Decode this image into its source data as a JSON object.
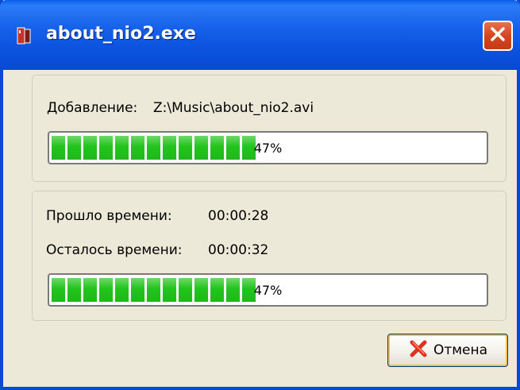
{
  "window": {
    "title": "about_nio2.exe",
    "titlebar_color": "#0b55e0"
  },
  "file_panel": {
    "adding_label": "Добавление:",
    "adding_path": "Z:\\Music\\about_nio2.avi",
    "progress_value": 47,
    "progress_text": "47%"
  },
  "time_panel": {
    "elapsed_label": "Прошло времени:",
    "elapsed_value": "00:00:28",
    "remaining_label": "Осталось времени:",
    "remaining_value": "00:00:32",
    "progress_value": 47,
    "progress_text": "47%"
  },
  "actions": {
    "cancel_label": "Отмена"
  },
  "icons": {
    "app": "app-icon",
    "close": "close-icon",
    "cancel": "red-x-icon"
  },
  "colors": {
    "progress_fill": "#22c41c",
    "close_button": "#d6461d"
  }
}
